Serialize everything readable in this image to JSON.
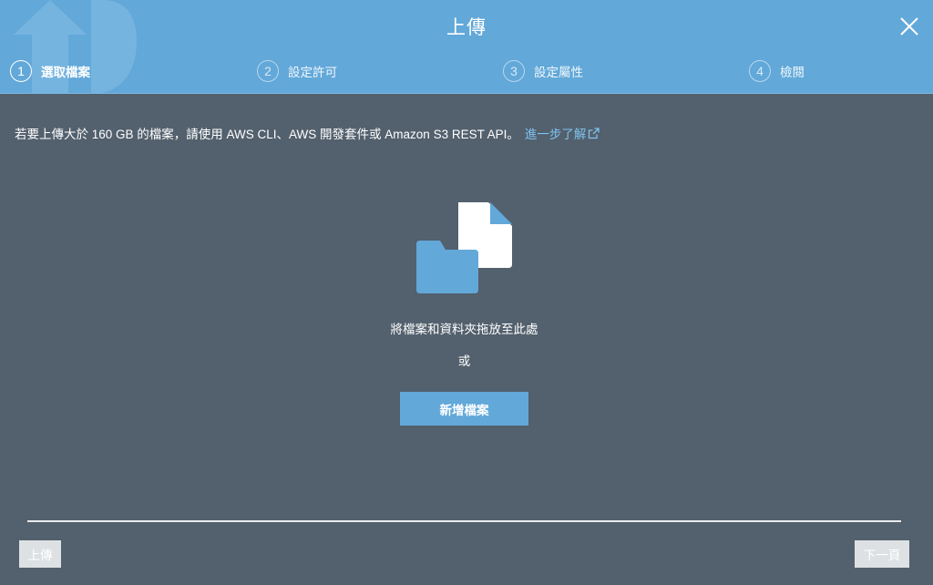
{
  "header": {
    "title": "上傳",
    "close_icon": "close-icon",
    "background_color": "#62a8d9"
  },
  "steps": [
    {
      "number": "1",
      "label": "選取檔案",
      "active": true
    },
    {
      "number": "2",
      "label": "設定許可",
      "active": false
    },
    {
      "number": "3",
      "label": "設定屬性",
      "active": false
    },
    {
      "number": "4",
      "label": "檢閱",
      "active": false
    }
  ],
  "notice": {
    "text": "若要上傳大於 160 GB 的檔案，請使用 AWS CLI、AWS 開發套件或 Amazon S3 REST API。",
    "link_label": "進一步了解",
    "link_icon": "external-link-icon"
  },
  "dropzone": {
    "icon": "folder-and-file-icon",
    "drop_text": "將檔案和資料夾拖放至此處",
    "or_text": "或",
    "add_button_label": "新增檔案"
  },
  "footer": {
    "upload_label": "上傳",
    "next_label": "下一頁"
  },
  "colors": {
    "accent": "#62a8d9",
    "body_background": "#53606d",
    "link": "#7fc3f0",
    "disabled_button": "#dde1e4"
  }
}
